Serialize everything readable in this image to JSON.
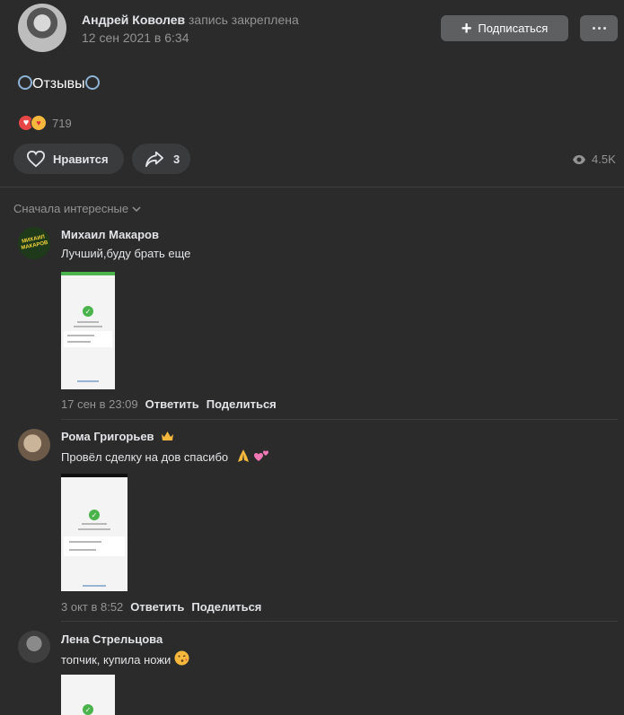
{
  "post": {
    "author": "Андрей Коволев",
    "pinned_note": "запись закреплена",
    "date": "12 сен 2021 в 6:34",
    "subscribe_label": "Подписаться",
    "text": "Отзывы",
    "reaction_count": "719",
    "like_label": "Нравится",
    "share_count": "3",
    "views": "4.5K"
  },
  "comments_section": {
    "sort_label": "Сначала интересные"
  },
  "comments": [
    {
      "author": "Михаил Макаров",
      "avatar_text": "МИХАИЛ МАКАРОВ",
      "text": "Лучший,буду брать еще",
      "date": "17 сен в 23:09",
      "reply_label": "Ответить",
      "share_label": "Поделиться"
    },
    {
      "author": "Рома Григорьев",
      "text": "Провёл сделку на дов спасибо",
      "date": "3 окт в 8:52",
      "reply_label": "Ответить",
      "share_label": "Поделиться"
    },
    {
      "author": "Лена Стрельцова",
      "text": "топчик, купила ножи"
    }
  ],
  "icons": {
    "subscribe": "plus-icon",
    "more": "more-dots-icon",
    "like": "heart-outline-icon",
    "share": "share-arrow-icon",
    "views": "eye-icon",
    "sort": "chevron-down-icon",
    "post_emoji": "ring-icon",
    "crown": "crown-icon"
  },
  "colors": {
    "background": "#2b2b2b",
    "button": "#5d5f61",
    "pill": "#3a3b3c",
    "text_primary": "#e1e3e6",
    "text_secondary": "#939393",
    "success_green": "#4bb34b"
  }
}
